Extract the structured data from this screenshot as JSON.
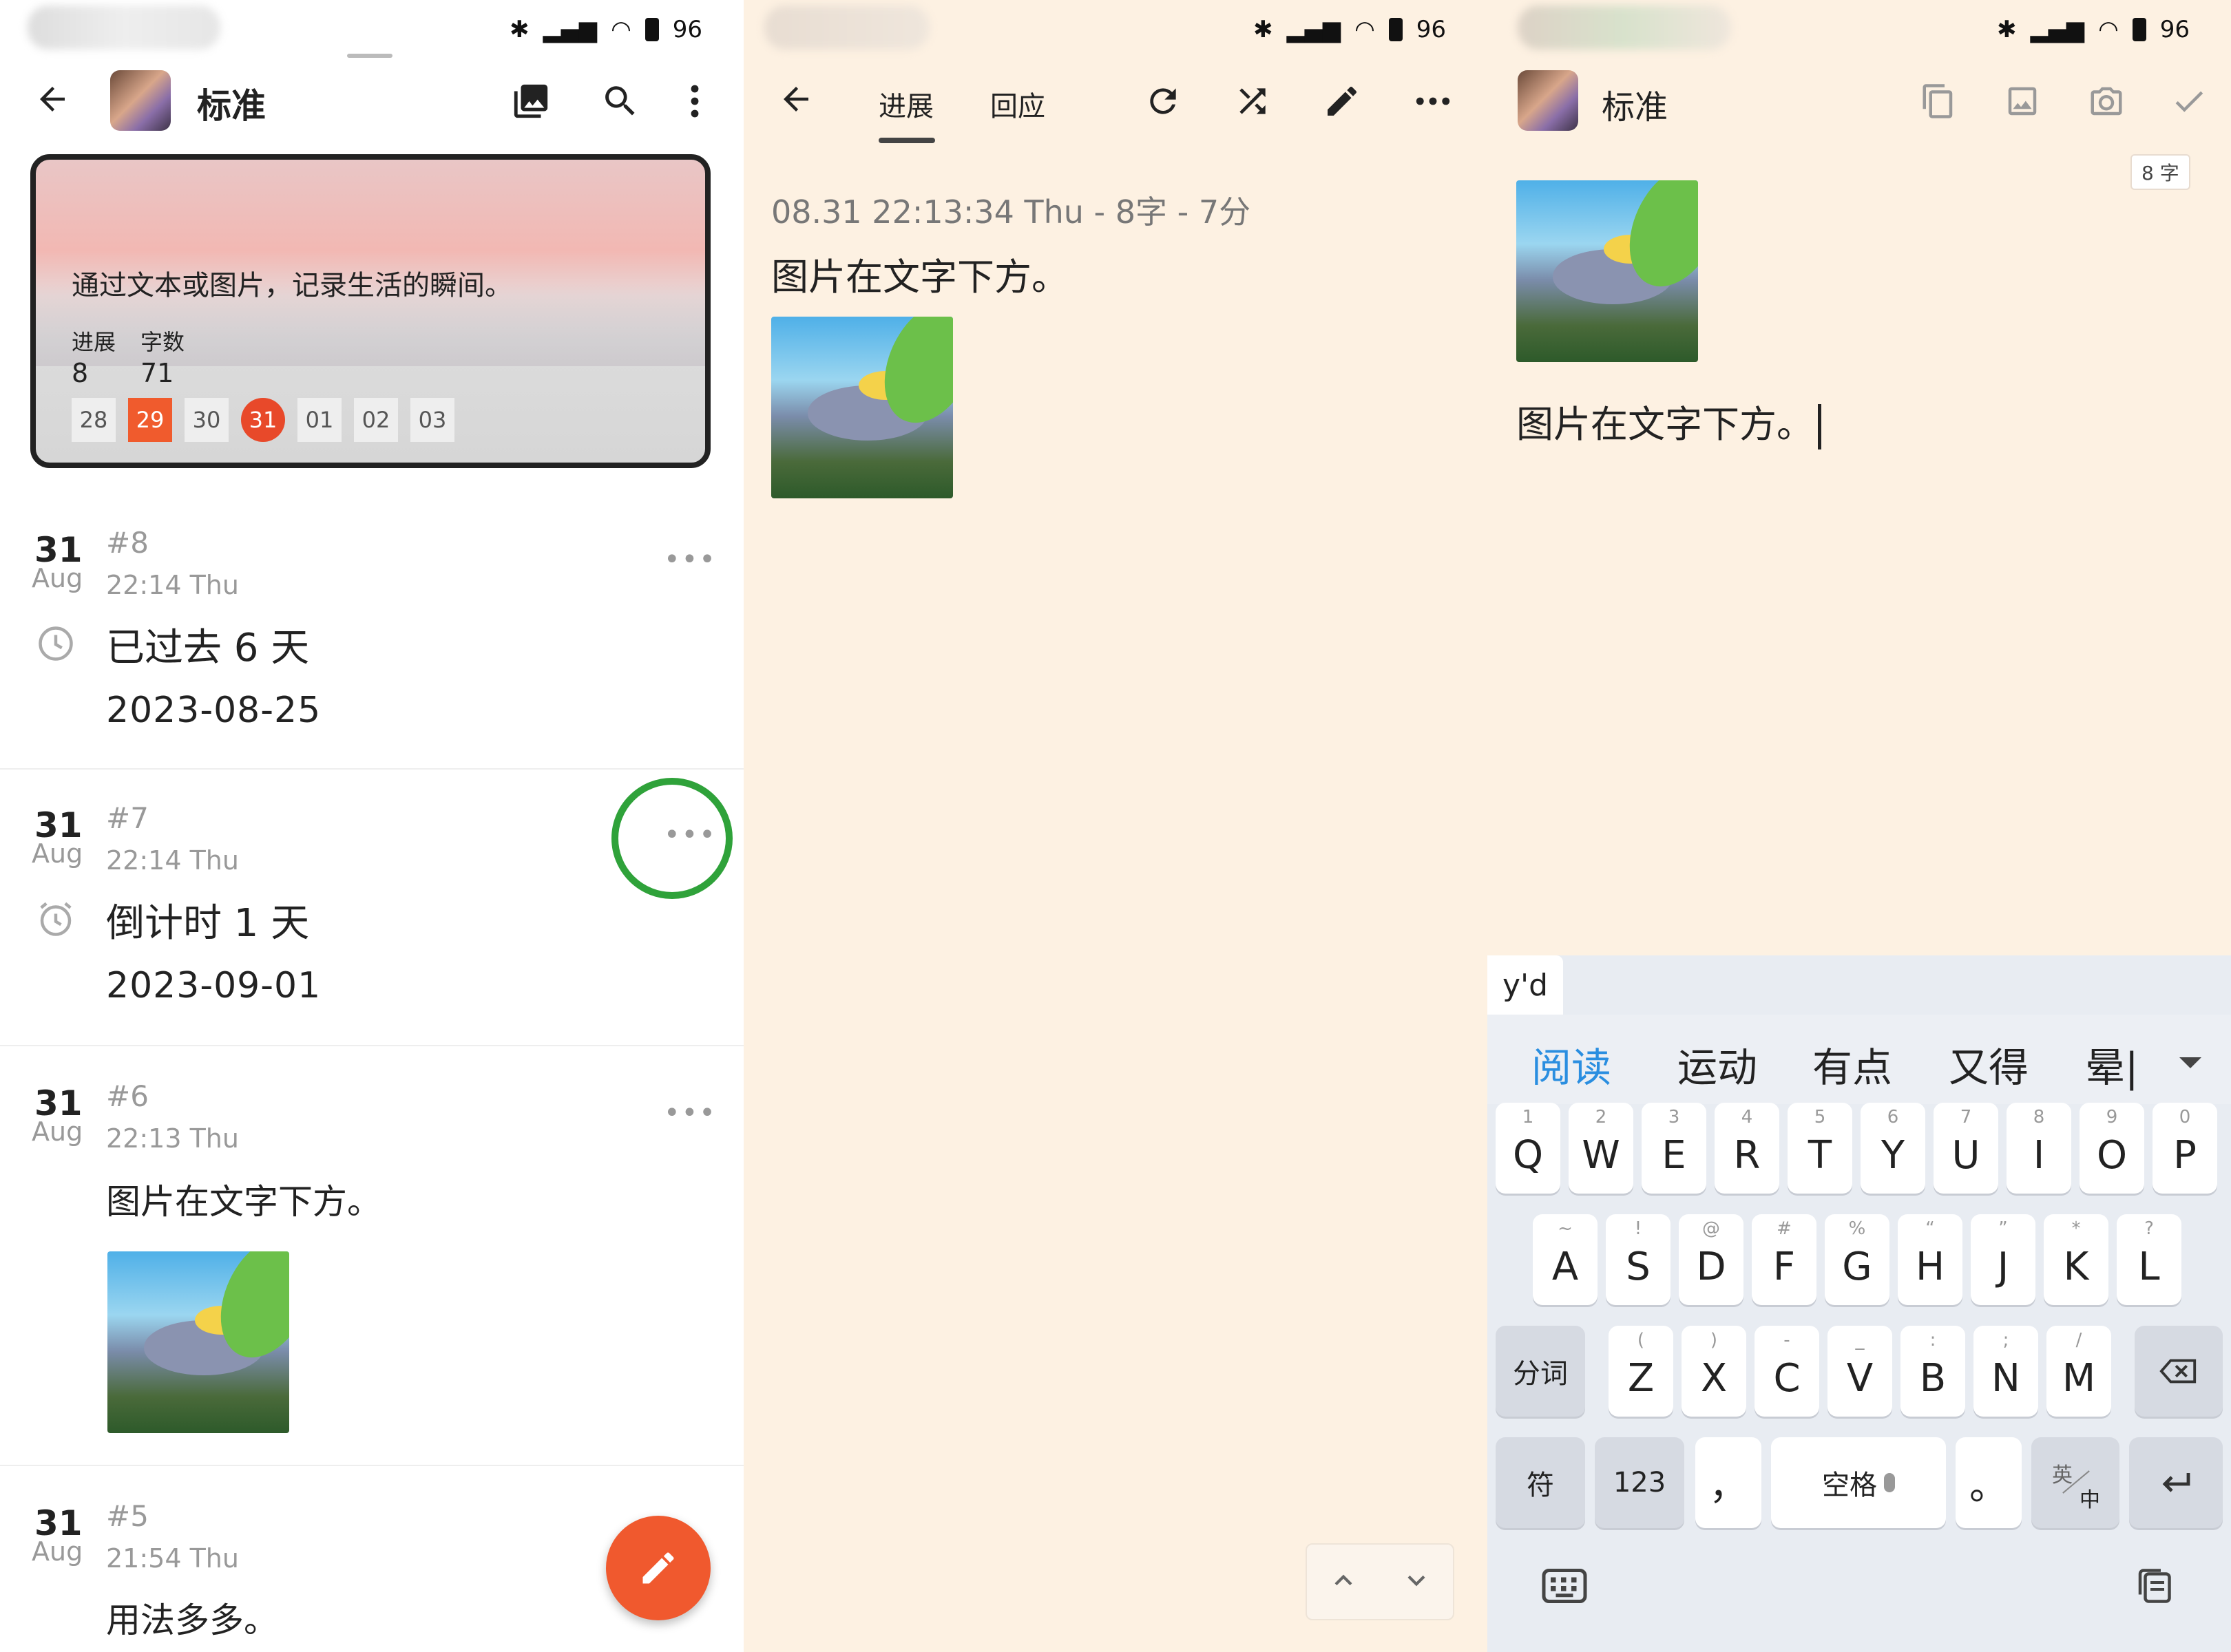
{
  "status": {
    "battery": "96"
  },
  "panel1": {
    "title": "标准",
    "card": {
      "motto": "通过文本或图片，记录生活的瞬间。",
      "stats": [
        {
          "label": "进展",
          "value": "8"
        },
        {
          "label": "字数",
          "value": "71"
        }
      ],
      "days": [
        "28",
        "29",
        "30",
        "31",
        "01",
        "02",
        "03"
      ],
      "selected_day": "29",
      "today": "31"
    },
    "entries": [
      {
        "day": "31",
        "month": "Aug",
        "id": "#8",
        "time": "22:14 Thu",
        "text": "已过去 6 天",
        "date": "2023-08-25",
        "icon": "clock-icon"
      },
      {
        "day": "31",
        "month": "Aug",
        "id": "#7",
        "time": "22:14 Thu",
        "text": "倒计时 1 天",
        "date": "2023-09-01",
        "icon": "alarm-icon"
      },
      {
        "day": "31",
        "month": "Aug",
        "id": "#6",
        "time": "22:13 Thu",
        "text": "图片在文字下方。"
      },
      {
        "day": "31",
        "month": "Aug",
        "id": "#5",
        "time": "21:54 Thu",
        "text": "用法多多。"
      }
    ],
    "more_label": "•••",
    "highlight_color": "#2fa23a",
    "accent_color": "#f0592e"
  },
  "panel2": {
    "tabs": [
      "进展",
      "回应"
    ],
    "active_tab": "进展",
    "meta": "08.31 22:13:34 Thu - 8字 - 7分",
    "text": "图片在文字下方。"
  },
  "panel3": {
    "title": "标准",
    "word_count": "8 字",
    "text": "图片在文字下方。",
    "keyboard": {
      "pinyin": "y'd",
      "candidates": [
        "阅读",
        "运动",
        "有点",
        "又得",
        "晕|"
      ],
      "row1": [
        {
          "k": "Q",
          "s": "1"
        },
        {
          "k": "W",
          "s": "2"
        },
        {
          "k": "E",
          "s": "3"
        },
        {
          "k": "R",
          "s": "4"
        },
        {
          "k": "T",
          "s": "5"
        },
        {
          "k": "Y",
          "s": "6"
        },
        {
          "k": "U",
          "s": "7"
        },
        {
          "k": "I",
          "s": "8"
        },
        {
          "k": "O",
          "s": "9"
        },
        {
          "k": "P",
          "s": "0"
        }
      ],
      "row2": [
        {
          "k": "A",
          "s": "~"
        },
        {
          "k": "S",
          "s": "!"
        },
        {
          "k": "D",
          "s": "@"
        },
        {
          "k": "F",
          "s": "#"
        },
        {
          "k": "G",
          "s": "%"
        },
        {
          "k": "H",
          "s": "“"
        },
        {
          "k": "J",
          "s": "”"
        },
        {
          "k": "K",
          "s": "*"
        },
        {
          "k": "L",
          "s": "?"
        }
      ],
      "row3_left": "分词",
      "row3": [
        {
          "k": "Z",
          "s": "("
        },
        {
          "k": "X",
          "s": ")"
        },
        {
          "k": "C",
          "s": "-"
        },
        {
          "k": "V",
          "s": "_"
        },
        {
          "k": "B",
          "s": ":"
        },
        {
          "k": "N",
          "s": ";"
        },
        {
          "k": "M",
          "s": "/"
        }
      ],
      "row4": {
        "symbols": "符",
        "numbers": "123",
        "comma": "，",
        "space": "空格",
        "period": "。",
        "lang_top": "英",
        "lang_bottom": "中"
      }
    }
  }
}
